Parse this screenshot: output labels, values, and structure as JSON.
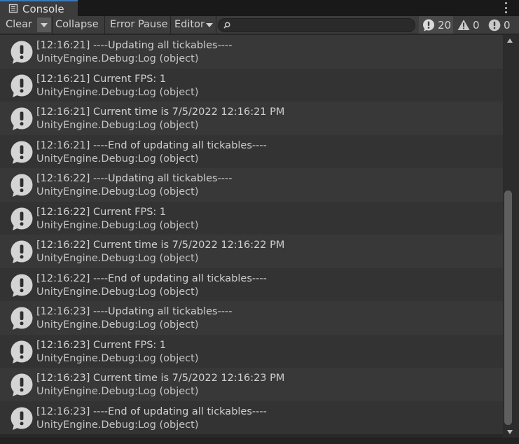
{
  "tab": {
    "title": "Console",
    "icon": "console-icon"
  },
  "toolbar": {
    "clear": "Clear",
    "collapse": "Collapse",
    "error_pause": "Error Pause",
    "editor": "Editor",
    "search": {
      "placeholder": "",
      "value": ""
    },
    "counts": {
      "info": "20",
      "warning": "0",
      "error": "0"
    }
  },
  "colors": {
    "tab_accent": "#3a79bb",
    "background": "#282828",
    "row_odd": "#383838",
    "row_even": "#333333"
  },
  "logs": [
    {
      "message": "[12:16:21] ----Updating all tickables----",
      "source": "UnityEngine.Debug:Log (object)"
    },
    {
      "message": "[12:16:21] Current FPS: 1",
      "source": "UnityEngine.Debug:Log (object)"
    },
    {
      "message": "[12:16:21] Current time is 7/5/2022 12:16:21 PM",
      "source": "UnityEngine.Debug:Log (object)"
    },
    {
      "message": "[12:16:21] ----End of updating all tickables----",
      "source": "UnityEngine.Debug:Log (object)"
    },
    {
      "message": "[12:16:22] ----Updating all tickables----",
      "source": "UnityEngine.Debug:Log (object)"
    },
    {
      "message": "[12:16:22] Current FPS: 1",
      "source": "UnityEngine.Debug:Log (object)"
    },
    {
      "message": "[12:16:22] Current time is 7/5/2022 12:16:22 PM",
      "source": "UnityEngine.Debug:Log (object)"
    },
    {
      "message": "[12:16:22] ----End of updating all tickables----",
      "source": "UnityEngine.Debug:Log (object)"
    },
    {
      "message": "[12:16:23] ----Updating all tickables----",
      "source": "UnityEngine.Debug:Log (object)"
    },
    {
      "message": "[12:16:23] Current FPS: 1",
      "source": "UnityEngine.Debug:Log (object)"
    },
    {
      "message": "[12:16:23] Current time is 7/5/2022 12:16:23 PM",
      "source": "UnityEngine.Debug:Log (object)"
    },
    {
      "message": "[12:16:23] ----End of updating all tickables----",
      "source": "UnityEngine.Debug:Log (object)"
    }
  ]
}
